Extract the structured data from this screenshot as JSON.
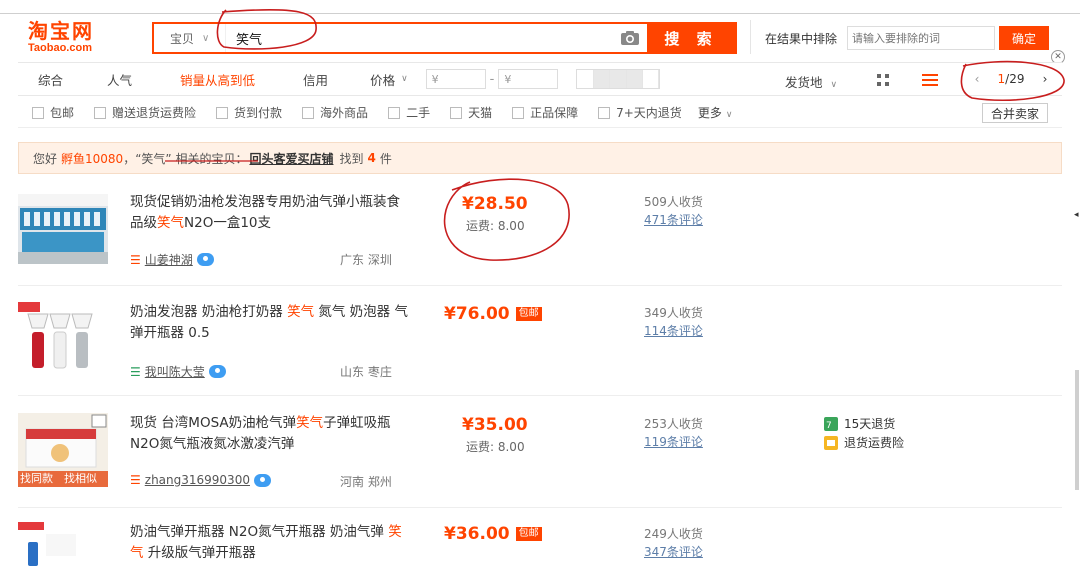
{
  "logo": {
    "cn": "淘宝网",
    "en": "Taobao.com"
  },
  "search": {
    "type": "宝贝",
    "query": "笑气",
    "button": "搜 索"
  },
  "exclude": {
    "label": "在结果中排除",
    "placeholder": "请输入要排除的词",
    "button": "确定"
  },
  "sort": {
    "items": [
      "综合",
      "人气",
      "销量从高到低",
      "信用",
      "价格"
    ],
    "price_from": "¥",
    "price_to": "¥",
    "price_sep": "-",
    "ship_from": "发货地"
  },
  "pager": {
    "current": "1",
    "total": "/29"
  },
  "filters": {
    "items": [
      "包邮",
      "赠送退货运费险",
      "货到付款",
      "海外商品",
      "二手",
      "天猫",
      "正品保障",
      "7+天内退货"
    ],
    "more": "更多",
    "merge": "合并卖家"
  },
  "notice": {
    "prefix": "您好",
    "user": "孵鱼10080",
    "mid": "，“笑气” 相关的宝贝：",
    "shop": "回头客爱买店铺",
    "found": "找到",
    "count": "4",
    "unit": "件"
  },
  "products": [
    {
      "title_a": "现货促销奶油枪发泡器专用奶油气弹小瓶装食品级",
      "title_kw": "笑气",
      "title_b": "N2O一盒10支",
      "shop": "山姜神湖",
      "location": "广东 深圳",
      "price": "¥28.50",
      "freight": "运费: 8.00",
      "sales": "509人收货",
      "comments": "471条评论"
    },
    {
      "title_a": "奶油发泡器 奶油枪打奶器 ",
      "title_kw": "笑气",
      "title_b": " 氮气 奶泡器 气弹开瓶器 0.5",
      "shop": "我叫陈大莹",
      "location": "山东 枣庄",
      "price": "¥76.00",
      "badge": "包邮",
      "sales": "349人收货",
      "comments": "114条评论"
    },
    {
      "title_a": "现货 台湾MOSA奶油枪气弹",
      "title_kw": "笑气",
      "title_b": "子弹虹吸瓶N2O氮气瓶液氮冰激凌汽弹",
      "shop": "zhang316990300",
      "location": "河南 郑州",
      "price": "¥35.00",
      "freight": "运费: 8.00",
      "sales": "253人收货",
      "comments": "119条评论",
      "thumb_tags": [
        "找同款",
        "找相似"
      ],
      "services": [
        "15天退货",
        "退货运费险"
      ]
    },
    {
      "title_a": "奶油气弹开瓶器 N2O氮气开瓶器 奶油气弹 ",
      "title_kw": "笑气",
      "title_b": " 升级版气弹开瓶器",
      "price": "¥36.00",
      "badge": "包邮",
      "sales": "249人收货",
      "comments": "347条评论"
    }
  ],
  "colors": {
    "accent": "#ff4400",
    "annotation": "#c81e1e",
    "link": "#5d7ea8",
    "notice_bg": "#fff1e6"
  },
  "icons": [
    "camera-icon",
    "grid-view-icon",
    "list-view-icon",
    "chevron-left-icon",
    "chevron-right-icon",
    "wangwang-icon",
    "close-icon"
  ]
}
